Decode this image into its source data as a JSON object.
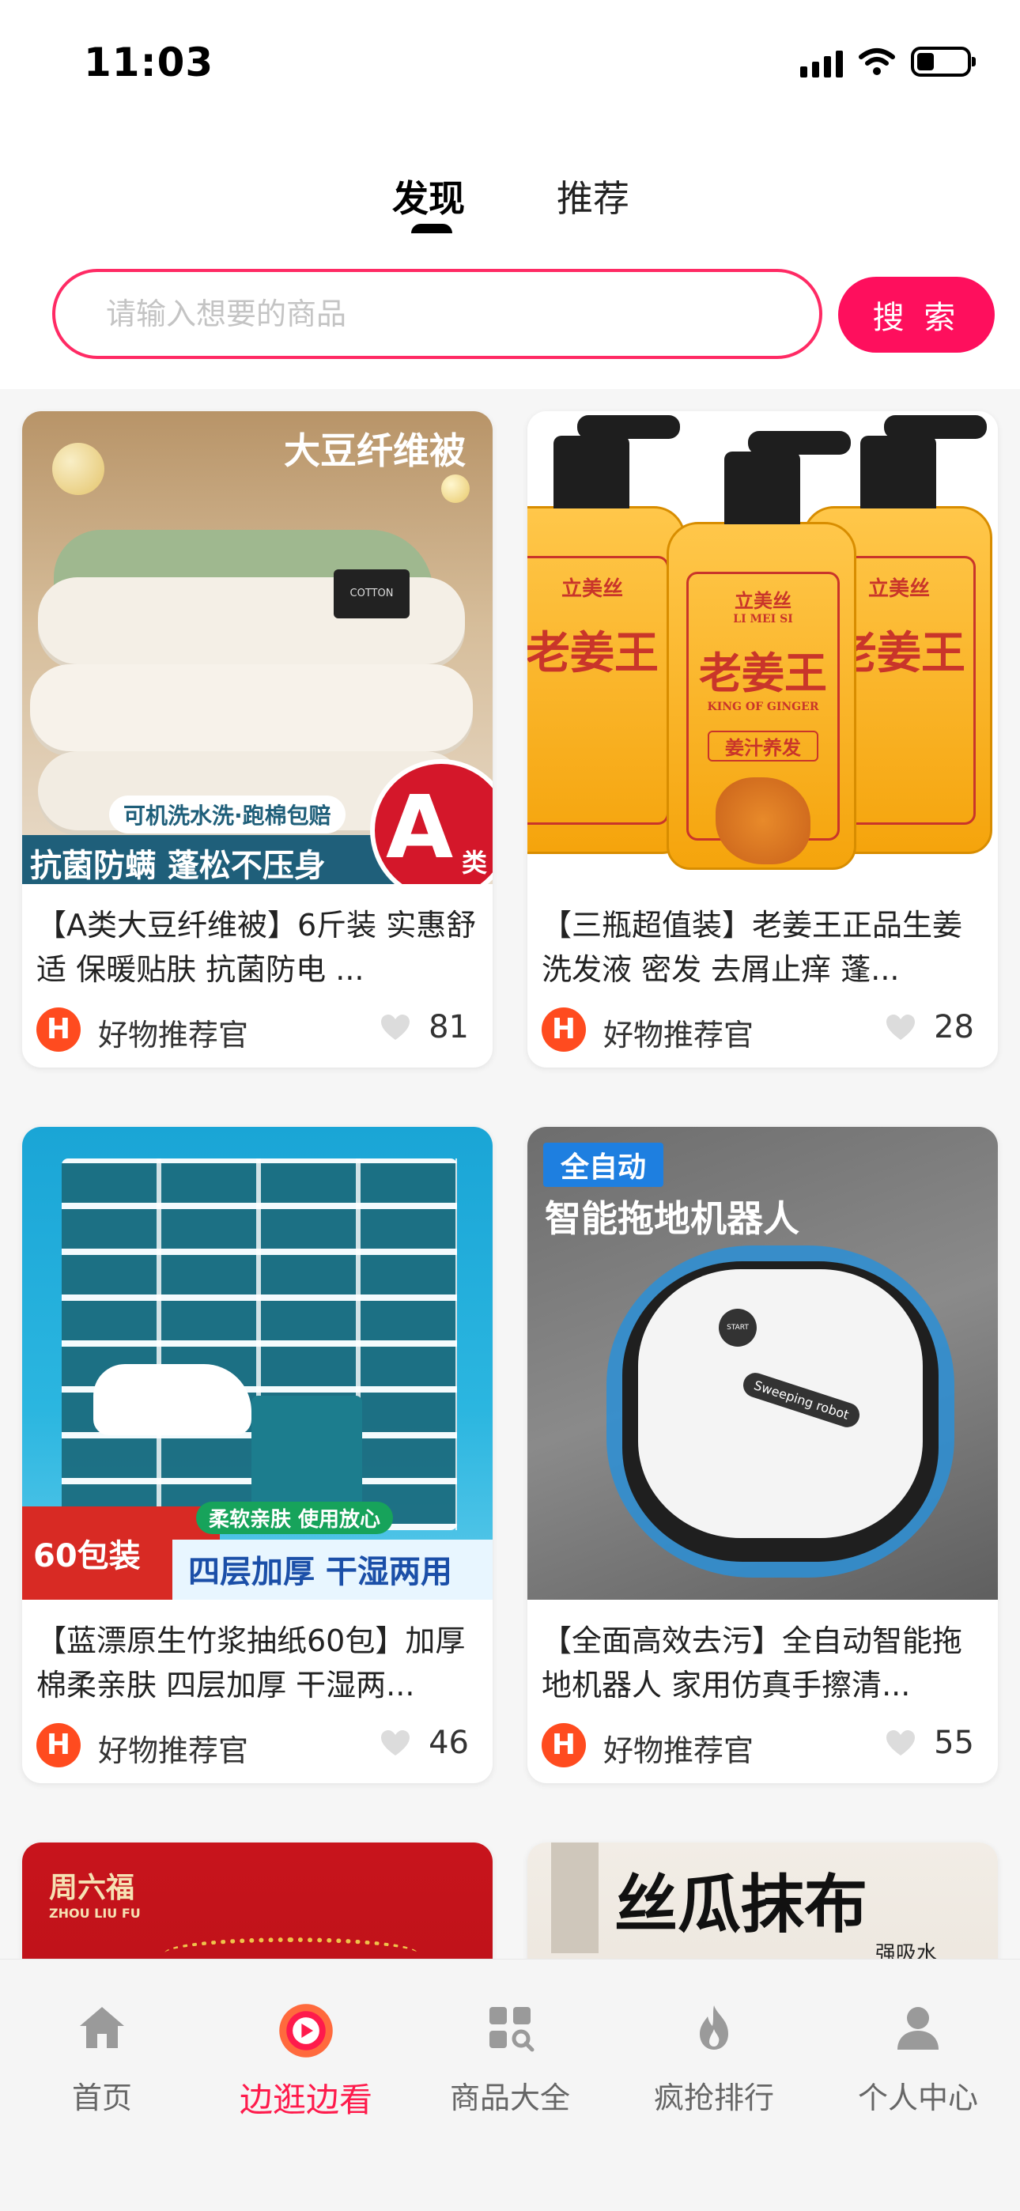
{
  "status_bar": {
    "time": "11:03",
    "battery_level": 0.35
  },
  "tabs": [
    {
      "label": "发现",
      "active": true
    },
    {
      "label": "推荐",
      "active": false
    }
  ],
  "search": {
    "placeholder": "请输入想要的商品",
    "button_label": "搜 索"
  },
  "products": [
    {
      "image_texts": {
        "headline": "大豆纤维被",
        "badge": "可机洗水洗·跑棉包赔",
        "banner": "抗菌防螨 蓬松不压身",
        "grade": "A",
        "grade_suffix": "类",
        "brand_tag": "COTTON"
      },
      "title": "【A类大豆纤维被】6斤装 实惠舒适 保暖贴肤 抗菌防电 ...",
      "shop": "好物推荐官",
      "likes": "81"
    },
    {
      "image_texts": {
        "brand": "立美丝",
        "brand_en": "LI MEI SI",
        "product": "老姜王",
        "product_en": "KING OF GINGER",
        "tag": "姜汁养发"
      },
      "title": "【三瓶超值装】老姜王正品生姜洗发液  密发 去屑止痒 蓬...",
      "shop": "好物推荐官",
      "likes": "28"
    },
    {
      "image_texts": {
        "pack": "60包装",
        "badge": "柔软亲肤 使用放心",
        "banner": "四层加厚 干湿两用"
      },
      "title": "【蓝漂原生竹浆抽纸60包】加厚棉柔亲肤 四层加厚 干湿两...",
      "shop": "好物推荐官",
      "likes": "46"
    },
    {
      "image_texts": {
        "tag": "全自动",
        "headline": "智能拖地机器人",
        "device_label": "Sweeping robot",
        "button": "START"
      },
      "title": "【全面高效去污】全自动智能拖地机器人 家用仿真手擦清...",
      "shop": "好物推荐官",
      "likes": "55"
    },
    {
      "image_texts": {
        "brand": "周六福",
        "brand_en": "ZHOU LIU FU"
      }
    },
    {
      "image_texts": {
        "headline": "丝瓜抹布",
        "tag": "强吸水"
      }
    }
  ],
  "nav": [
    {
      "label": "首页",
      "icon": "home-icon",
      "active": false
    },
    {
      "label": "边逛边看",
      "icon": "play-icon",
      "active": true
    },
    {
      "label": "商品大全",
      "icon": "category-icon",
      "active": false
    },
    {
      "label": "疯抢排行",
      "icon": "fire-icon",
      "active": false
    },
    {
      "label": "个人中心",
      "icon": "person-icon",
      "active": false
    }
  ],
  "colors": {
    "accent": "#fe0f5d",
    "nav_active": "#fe1b4c",
    "search_border": "#ff2a64"
  }
}
